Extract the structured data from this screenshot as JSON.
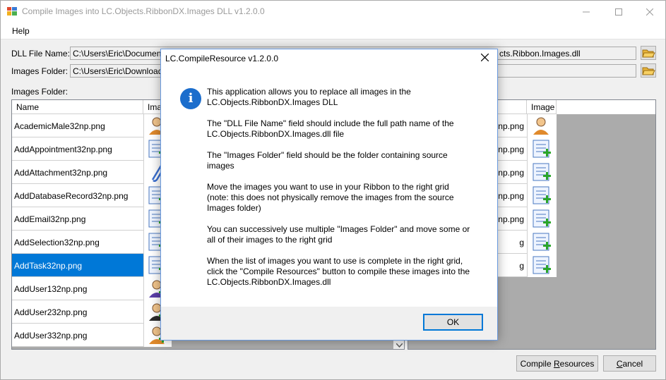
{
  "window": {
    "title": "Compile Images into LC.Objects.RibbonDX.Images DLL v1.2.0.0"
  },
  "menu": {
    "help": "Help"
  },
  "form": {
    "dll_label": "DLL File Name:",
    "dll_value_left": "C:\\Users\\Eric\\Documents",
    "dll_value_right": "cts.Ribbon.Images.dll",
    "images_label": "Images Folder:",
    "images_value_left": "C:\\Users\\Eric\\Downloads",
    "grid_label": "Images Folder:"
  },
  "left_grid": {
    "col_name": "Name",
    "col_image": "Imag",
    "rows": [
      "AcademicMale32np.png",
      "AddAppointment32np.png",
      "AddAttachment32np.png",
      "AddDatabaseRecord32np.png",
      "AddEmail32np.png",
      "AddSelection32np.png",
      "AddTask32np.png",
      "AddUser132np.png",
      "AddUser232np.png",
      "AddUser332np.png"
    ],
    "selected_index": 6
  },
  "right_grid": {
    "col_image": "Image",
    "rows": [
      "32np.png",
      "np.png",
      "np.png",
      "np.png",
      "np.png",
      "g",
      "g"
    ]
  },
  "buttons": {
    "compile_pre": "Compile ",
    "compile_u": "R",
    "compile_post": "esources",
    "cancel_u": "C",
    "cancel_post": "ancel"
  },
  "dialog": {
    "title": "LC.CompileResource v1.2.0.0",
    "ok": "OK",
    "paragraphs": [
      "This application allows you to replace all images in the\nLC.Objects.RibbonDX.Images DLL",
      "The \"DLL File Name\" field should include the full path name of the\nLC.Objects.RibbonDX.Images.dll file",
      "The \"Images Folder\" field should be the folder containing source\nimages",
      "Move the images you want to use in your Ribbon to the right grid\n(note: this does not physically remove the images from the source\nImages folder)",
      "You can successively use multiple \"Images Folder\" and move some or\nall of their images to the right grid",
      "When the list of images you want to use is complete in the right grid,\nclick the \"Compile Resources\" button to compile these images into the\nLC.Objects.RibbonDX.Images.dll"
    ]
  },
  "colors": {
    "selection": "#0078d7",
    "info_icon": "#1b6dcc"
  }
}
